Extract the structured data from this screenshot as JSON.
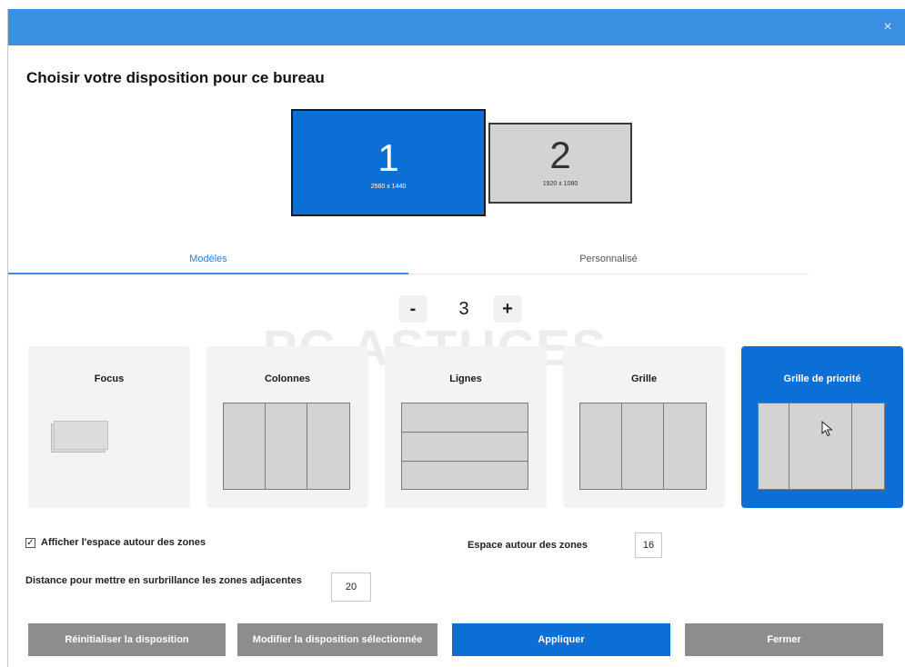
{
  "window": {
    "close_glyph": "×"
  },
  "heading": "Choisir votre disposition pour ce bureau",
  "monitors": [
    {
      "number": "1",
      "resolution": "2560 x 1440",
      "selected": true
    },
    {
      "number": "2",
      "resolution": "1920 x 1080",
      "selected": false
    }
  ],
  "tabs": [
    {
      "label": "Modèles",
      "active": true
    },
    {
      "label": "Personnalisé",
      "active": false
    }
  ],
  "zone_count": {
    "minus": "-",
    "value": "3",
    "plus": "+"
  },
  "watermark": "PC ASTUCES",
  "layouts": [
    {
      "label": "Focus",
      "selected": false
    },
    {
      "label": "Colonnes",
      "selected": false
    },
    {
      "label": "Lignes",
      "selected": false
    },
    {
      "label": "Grille",
      "selected": false
    },
    {
      "label": "Grille de priorité",
      "selected": true
    }
  ],
  "options": {
    "show_space_label": "Afficher l'espace autour des zones",
    "show_space_checked": true,
    "space_around_label": "Espace autour des zones",
    "space_around_value": "16",
    "highlight_distance_label": "Distance pour mettre en surbrillance les zones adjacentes",
    "highlight_distance_value": "20"
  },
  "buttons": {
    "reset": "Réinitialiser la disposition",
    "edit": "Modifier la disposition sélectionnée",
    "apply": "Appliquer",
    "close": "Fermer"
  },
  "colors": {
    "accent": "#0b6fd6",
    "titlebar": "#3b8fe0",
    "secondary_button": "#8d8d8d"
  }
}
